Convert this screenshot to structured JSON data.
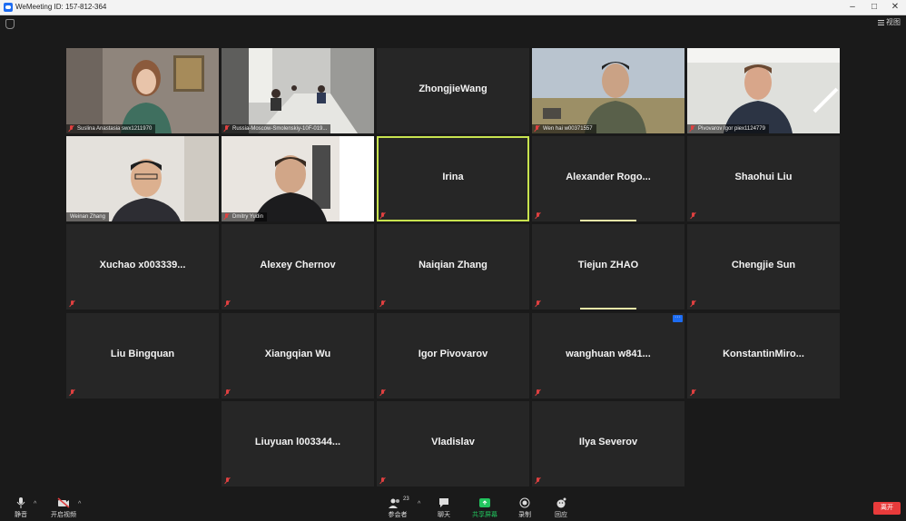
{
  "window": {
    "title": "WeMeeting ID: 157-812-364",
    "minimize": "–",
    "maximize": "□",
    "close": "✕"
  },
  "view_button": {
    "label": "视图",
    "icon": "grid-view-icon"
  },
  "participants": {
    "video_tiles": [
      {
        "label": "Suslina Anastasia swx1211970"
      },
      {
        "label": "Russia-Moscow-Smolenskiy-10F-019..."
      },
      {
        "label": "Wen hai w00371557"
      },
      {
        "label": "Pivovarov Igor piex1124779"
      },
      {
        "label": "Weinan Zhang"
      },
      {
        "label": "Dmitry Yudin"
      }
    ],
    "name_tiles": [
      {
        "name": "ZhongjieWang"
      },
      {
        "name": "Irina"
      },
      {
        "name": "Alexander  Rogo..."
      },
      {
        "name": "Shaohui Liu"
      },
      {
        "name": "Xuchao  x003339..."
      },
      {
        "name": "Alexey Chernov"
      },
      {
        "name": "Naiqian Zhang"
      },
      {
        "name": "Tiejun ZHAO"
      },
      {
        "name": "Chengjie Sun"
      },
      {
        "name": "Liu Bingquan"
      },
      {
        "name": "Xiangqian Wu"
      },
      {
        "name": "Igor Pivovarov"
      },
      {
        "name": "wanghuan  w841..."
      },
      {
        "name": "KonstantinMiro..."
      },
      {
        "name": "Liuyuan  l003344..."
      },
      {
        "name": "Vladislav"
      },
      {
        "name": "Ilya Severov"
      }
    ]
  },
  "toolbar": {
    "mute": "静音",
    "video": "开启视频",
    "participants": "参会者",
    "participant_count": "23",
    "chat": "聊天",
    "share": "共享屏幕",
    "record": "录制",
    "reactions": "回应",
    "leave": "离开"
  },
  "colors": {
    "active_speaker": "#c8e34f",
    "share": "#22c55e",
    "leave": "#e83b3b",
    "brand": "#1d6cf2"
  }
}
